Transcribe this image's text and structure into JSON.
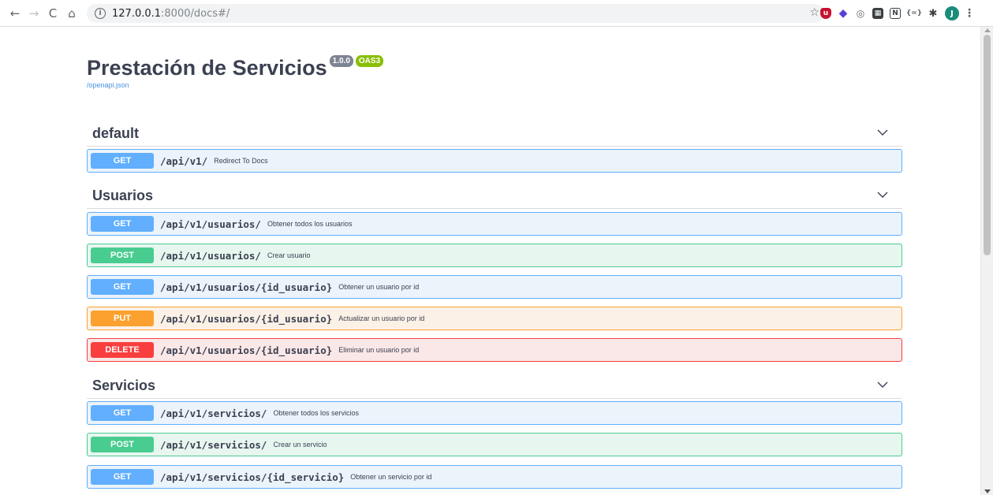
{
  "browser": {
    "url_host": "127.0.0.1",
    "url_path": ":8000/docs#/",
    "avatar_letter": "J"
  },
  "info": {
    "title": "Prestación de Servicios",
    "version": "1.0.0",
    "oas": "OAS3",
    "spec_link": "/openapi.json"
  },
  "tags": [
    {
      "name": "default",
      "operations": [
        {
          "method": "GET",
          "path": "/api/v1/",
          "summary": "Redirect To Docs"
        }
      ]
    },
    {
      "name": "Usuarios",
      "operations": [
        {
          "method": "GET",
          "path": "/api/v1/usuarios/",
          "summary": "Obtener todos los usuarios"
        },
        {
          "method": "POST",
          "path": "/api/v1/usuarios/",
          "summary": "Crear usuario"
        },
        {
          "method": "GET",
          "path": "/api/v1/usuarios/{id_usuario}",
          "summary": "Obtener un usuario por id"
        },
        {
          "method": "PUT",
          "path": "/api/v1/usuarios/{id_usuario}",
          "summary": "Actualizar un usuario por id"
        },
        {
          "method": "DELETE",
          "path": "/api/v1/usuarios/{id_usuario}",
          "summary": "Eliminar un usuario por id"
        }
      ]
    },
    {
      "name": "Servicios",
      "operations": [
        {
          "method": "GET",
          "path": "/api/v1/servicios/",
          "summary": "Obtener todos los servicios"
        },
        {
          "method": "POST",
          "path": "/api/v1/servicios/",
          "summary": "Crear un servicio"
        },
        {
          "method": "GET",
          "path": "/api/v1/servicios/{id_servicio}",
          "summary": "Obtener un servicio por id"
        }
      ]
    }
  ],
  "colors": {
    "get": "#61affe",
    "post": "#49cc90",
    "put": "#fca130",
    "delete": "#f93e3e"
  }
}
